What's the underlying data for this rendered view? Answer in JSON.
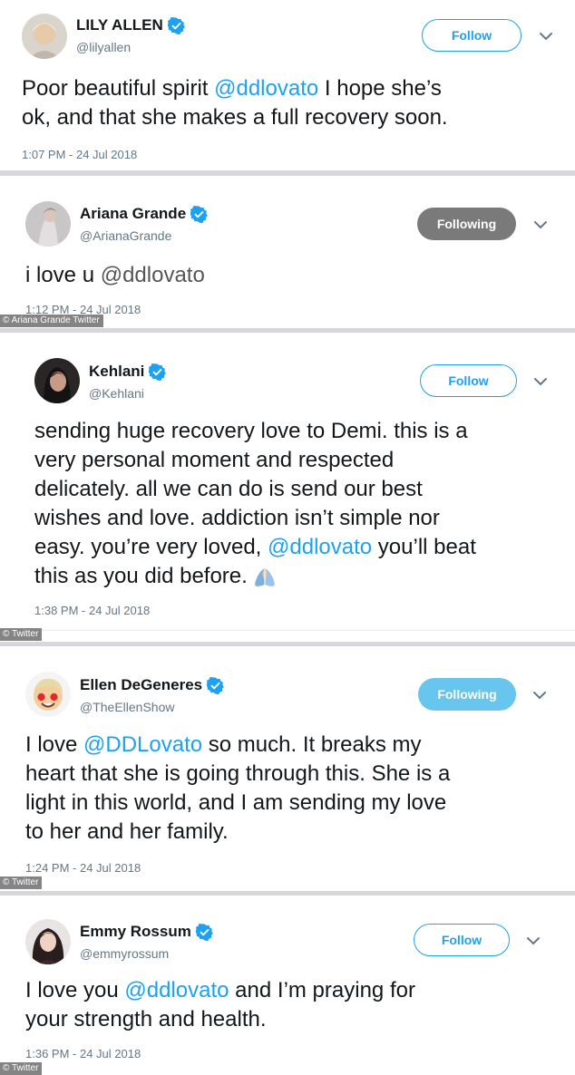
{
  "tweets": [
    {
      "name": "LILY ALLEN",
      "handle": "@lilyallen",
      "button": "Follow",
      "text_parts": [
        "Poor beautiful spirit ",
        "@ddlovato",
        " I hope she’s",
        "ok, and that she makes a full recovery soon."
      ],
      "time": "1:07 PM - 24 Jul 2018",
      "credit": ""
    },
    {
      "name": "Ariana Grande",
      "handle": "@ArianaGrande",
      "button": "Following",
      "text_parts": [
        "i love u ",
        "@ddlovato"
      ],
      "time": "1:12 PM - 24 Jul 2018",
      "credit": "© Ariana Grande Twitter"
    },
    {
      "name": "Kehlani",
      "handle": "@Kehlani",
      "button": "Follow",
      "text_lines": [
        "sending huge recovery love to Demi. this is a",
        "very personal moment and respected",
        "delicately. all we can do is send our best",
        "wishes and love. addiction isn’t simple nor"
      ],
      "text_line5a": "easy. you’re very loved, ",
      "text_mention": "@ddlovato",
      "text_line5b": " you’ll beat",
      "text_line6": "this as you did before. ",
      "emoji": "praying-hands",
      "time": "1:38 PM - 24 Jul 2018",
      "credit": "© Twitter"
    },
    {
      "name": "Ellen DeGeneres",
      "handle": "@TheEllenShow",
      "button": "Following",
      "text_line1a": "I love ",
      "text_mention": "@DDLovato",
      "text_line1b": " so much. It breaks my",
      "text_lines": [
        "heart that she is going through this. She is a",
        "light in this world, and I am sending my love",
        "to her and her family."
      ],
      "time": "1:24 PM - 24 Jul 2018",
      "credit": "© Twitter"
    },
    {
      "name": "Emmy Rossum",
      "handle": "@emmyrossum",
      "button": "Follow",
      "text_line1a": "I love you ",
      "text_mention": "@ddlovato",
      "text_line1b": " and I’m praying for",
      "text_line2": "your strength and health.",
      "time": "1:36 PM - 24 Jul 2018",
      "credit": "© Twitter"
    }
  ],
  "colors": {
    "accent": "#1da1f2",
    "verified": "#1da1f2",
    "following_grey": "#7a7a7a",
    "following_blue": "#67c5ee",
    "separator": "#d5d7da"
  },
  "icons": [
    "verified-badge-icon",
    "chevron-down-icon",
    "praying-hands-emoji"
  ]
}
